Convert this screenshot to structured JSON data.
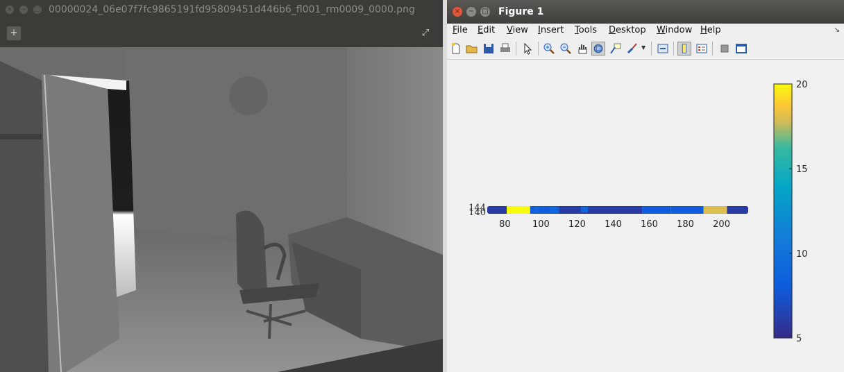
{
  "viewer": {
    "title": "00000024_06e07f7fc9865191fd95809451d446b6_fl001_rm0009_0000.png",
    "toolbar": {
      "add_icon": "plus-icon",
      "fullscreen_icon": "expand-icon"
    }
  },
  "figure": {
    "title": "Figure 1",
    "menu": [
      {
        "accel": "F",
        "rest": "ile"
      },
      {
        "accel": "E",
        "rest": "dit"
      },
      {
        "accel": "V",
        "rest": "iew"
      },
      {
        "accel": "I",
        "rest": "nsert"
      },
      {
        "accel": "T",
        "rest": "ools"
      },
      {
        "accel": "D",
        "rest": "esktop"
      },
      {
        "accel": "W",
        "rest": "indow"
      },
      {
        "accel": "H",
        "rest": "elp"
      }
    ],
    "toolbar_icons": [
      "new-figure-icon",
      "open-file-icon",
      "save-icon",
      "print-icon",
      "edit-plot-icon",
      "zoom-in-icon",
      "zoom-out-icon",
      "pan-icon",
      "rotate-3d-icon",
      "data-cursor-icon",
      "brush-icon",
      "link-plot-icon",
      "colorbar-icon",
      "legend-icon",
      "hide-plot-tools-icon",
      "show-plot-tools-icon"
    ],
    "accent": "#e0573c"
  },
  "chart_data": {
    "type": "heatmap",
    "title": "",
    "xlabel": "",
    "ylabel": "",
    "x_ticks": [
      80,
      100,
      120,
      140,
      160,
      180,
      200
    ],
    "y_ticks": [
      140,
      144
    ],
    "xlim": [
      71,
      214
    ],
    "ylim": [
      138,
      146
    ],
    "colorbar": {
      "ticks": [
        5,
        10,
        15,
        20
      ],
      "range": [
        5,
        20
      ],
      "colormap": "parula"
    },
    "segments": [
      {
        "x0": 71,
        "x1": 81,
        "value": 6
      },
      {
        "x0": 81,
        "x1": 94,
        "value": 20
      },
      {
        "x0": 94,
        "x1": 110,
        "value": 8
      },
      {
        "x0": 110,
        "x1": 125,
        "value": 6
      },
      {
        "x0": 125,
        "x1": 156,
        "value": 6
      },
      {
        "x0": 156,
        "x1": 172,
        "value": 8
      },
      {
        "x0": 172,
        "x1": 190,
        "value": 8
      },
      {
        "x0": 190,
        "x1": 203,
        "value": 18
      },
      {
        "x0": 203,
        "x1": 214,
        "value": 6
      }
    ],
    "highlights": [
      {
        "x0": 96,
        "x1": 99,
        "value": 9
      },
      {
        "x0": 105,
        "x1": 109,
        "value": 9
      },
      {
        "x0": 122,
        "x1": 126,
        "value": 9
      }
    ]
  }
}
